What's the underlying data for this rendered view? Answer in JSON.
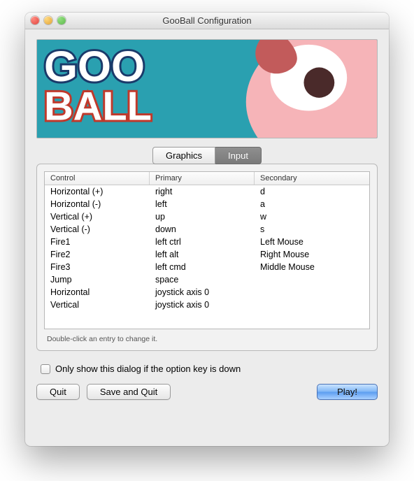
{
  "window": {
    "title": "GooBall Configuration"
  },
  "banner": {
    "logo_line1": "GOO",
    "logo_line2": "BALL"
  },
  "tabs": {
    "graphics": "Graphics",
    "input": "Input",
    "active": "input"
  },
  "table": {
    "headers": {
      "control": "Control",
      "primary": "Primary",
      "secondary": "Secondary"
    },
    "rows": [
      {
        "control": "Horizontal (+)",
        "primary": "right",
        "secondary": "d"
      },
      {
        "control": "Horizontal (-)",
        "primary": "left",
        "secondary": "a"
      },
      {
        "control": "Vertical (+)",
        "primary": "up",
        "secondary": "w"
      },
      {
        "control": "Vertical (-)",
        "primary": "down",
        "secondary": "s"
      },
      {
        "control": "Fire1",
        "primary": "left ctrl",
        "secondary": "Left Mouse"
      },
      {
        "control": "Fire2",
        "primary": "left alt",
        "secondary": "Right Mouse"
      },
      {
        "control": "Fire3",
        "primary": "left cmd",
        "secondary": "Middle Mouse"
      },
      {
        "control": "Jump",
        "primary": "space",
        "secondary": ""
      },
      {
        "control": "Horizontal",
        "primary": "joystick axis 0",
        "secondary": ""
      },
      {
        "control": "Vertical",
        "primary": "joystick axis 0",
        "secondary": ""
      }
    ],
    "hint": "Double-click an entry to change it."
  },
  "checkbox": {
    "label": "Only show this dialog if the option key is down",
    "checked": false
  },
  "buttons": {
    "quit": "Quit",
    "save_and_quit": "Save and Quit",
    "play": "Play!"
  }
}
